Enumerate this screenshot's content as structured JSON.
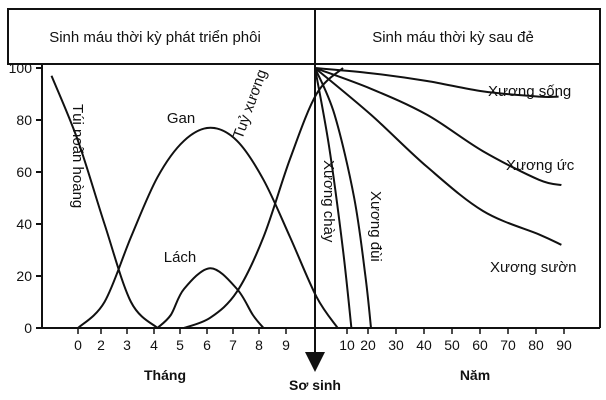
{
  "chart_data": {
    "type": "line",
    "header": {
      "left": "Sinh máu thời kỳ phát triển phôi",
      "right": "Sinh máu thời kỳ sau đẻ"
    },
    "y_axis": {
      "ylim": [
        0,
        100
      ],
      "ticks": [
        "100",
        "80",
        "60",
        "40",
        "20",
        "0"
      ]
    },
    "x_left": {
      "label": "Tháng",
      "ticks": [
        "0",
        "2",
        "3",
        "4",
        "5",
        "6",
        "7",
        "8",
        "9"
      ]
    },
    "x_right": {
      "label": "Năm",
      "ticks": [
        "10",
        "20",
        "30",
        "40",
        "50",
        "60",
        "70",
        "80",
        "90"
      ]
    },
    "birth_label": "Sơ sinh",
    "series": [
      {
        "name": "Túi noãn hoàng",
        "x_unit": "month",
        "points": [
          [
            -1,
            97
          ],
          [
            0,
            72
          ],
          [
            1,
            40
          ],
          [
            2,
            10
          ],
          [
            3,
            0
          ]
        ]
      },
      {
        "name": "Gan",
        "x_unit": "month",
        "points": [
          [
            0,
            0
          ],
          [
            1,
            10
          ],
          [
            2,
            35
          ],
          [
            3,
            58
          ],
          [
            4,
            72
          ],
          [
            5,
            77
          ],
          [
            6,
            72
          ],
          [
            7,
            57
          ],
          [
            8,
            35
          ],
          [
            9,
            12
          ],
          [
            9.8,
            0
          ]
        ]
      },
      {
        "name": "Lách",
        "x_unit": "month",
        "points": [
          [
            3,
            0
          ],
          [
            3.5,
            5
          ],
          [
            4,
            15
          ],
          [
            5,
            23
          ],
          [
            6,
            15
          ],
          [
            6.6,
            5
          ],
          [
            7,
            0
          ]
        ]
      },
      {
        "name": "Tuỷ xương",
        "x_unit": "month",
        "points": [
          [
            4,
            0
          ],
          [
            5,
            4
          ],
          [
            6,
            14
          ],
          [
            7,
            35
          ],
          [
            8,
            65
          ],
          [
            9,
            90
          ],
          [
            10,
            100
          ]
        ]
      },
      {
        "name": "Xương chày",
        "x_unit": "year",
        "points": [
          [
            0,
            100
          ],
          [
            5,
            70
          ],
          [
            10,
            30
          ],
          [
            13,
            0
          ]
        ]
      },
      {
        "name": "Xương đùi",
        "x_unit": "year",
        "points": [
          [
            0,
            100
          ],
          [
            7,
            82
          ],
          [
            14,
            50
          ],
          [
            18,
            20
          ],
          [
            20,
            0
          ]
        ]
      },
      {
        "name": "Xương sống",
        "x_unit": "year",
        "points": [
          [
            0,
            100
          ],
          [
            20,
            98
          ],
          [
            40,
            95
          ],
          [
            60,
            91
          ],
          [
            80,
            89
          ],
          [
            87,
            89
          ]
        ]
      },
      {
        "name": "Xương ức",
        "x_unit": "year",
        "points": [
          [
            0,
            100
          ],
          [
            20,
            92
          ],
          [
            40,
            82
          ],
          [
            60,
            68
          ],
          [
            80,
            57
          ],
          [
            88,
            55
          ]
        ]
      },
      {
        "name": "Xương sườn",
        "x_unit": "year",
        "points": [
          [
            0,
            100
          ],
          [
            20,
            82
          ],
          [
            40,
            62
          ],
          [
            60,
            45
          ],
          [
            80,
            36
          ],
          [
            88,
            32
          ]
        ]
      }
    ]
  }
}
